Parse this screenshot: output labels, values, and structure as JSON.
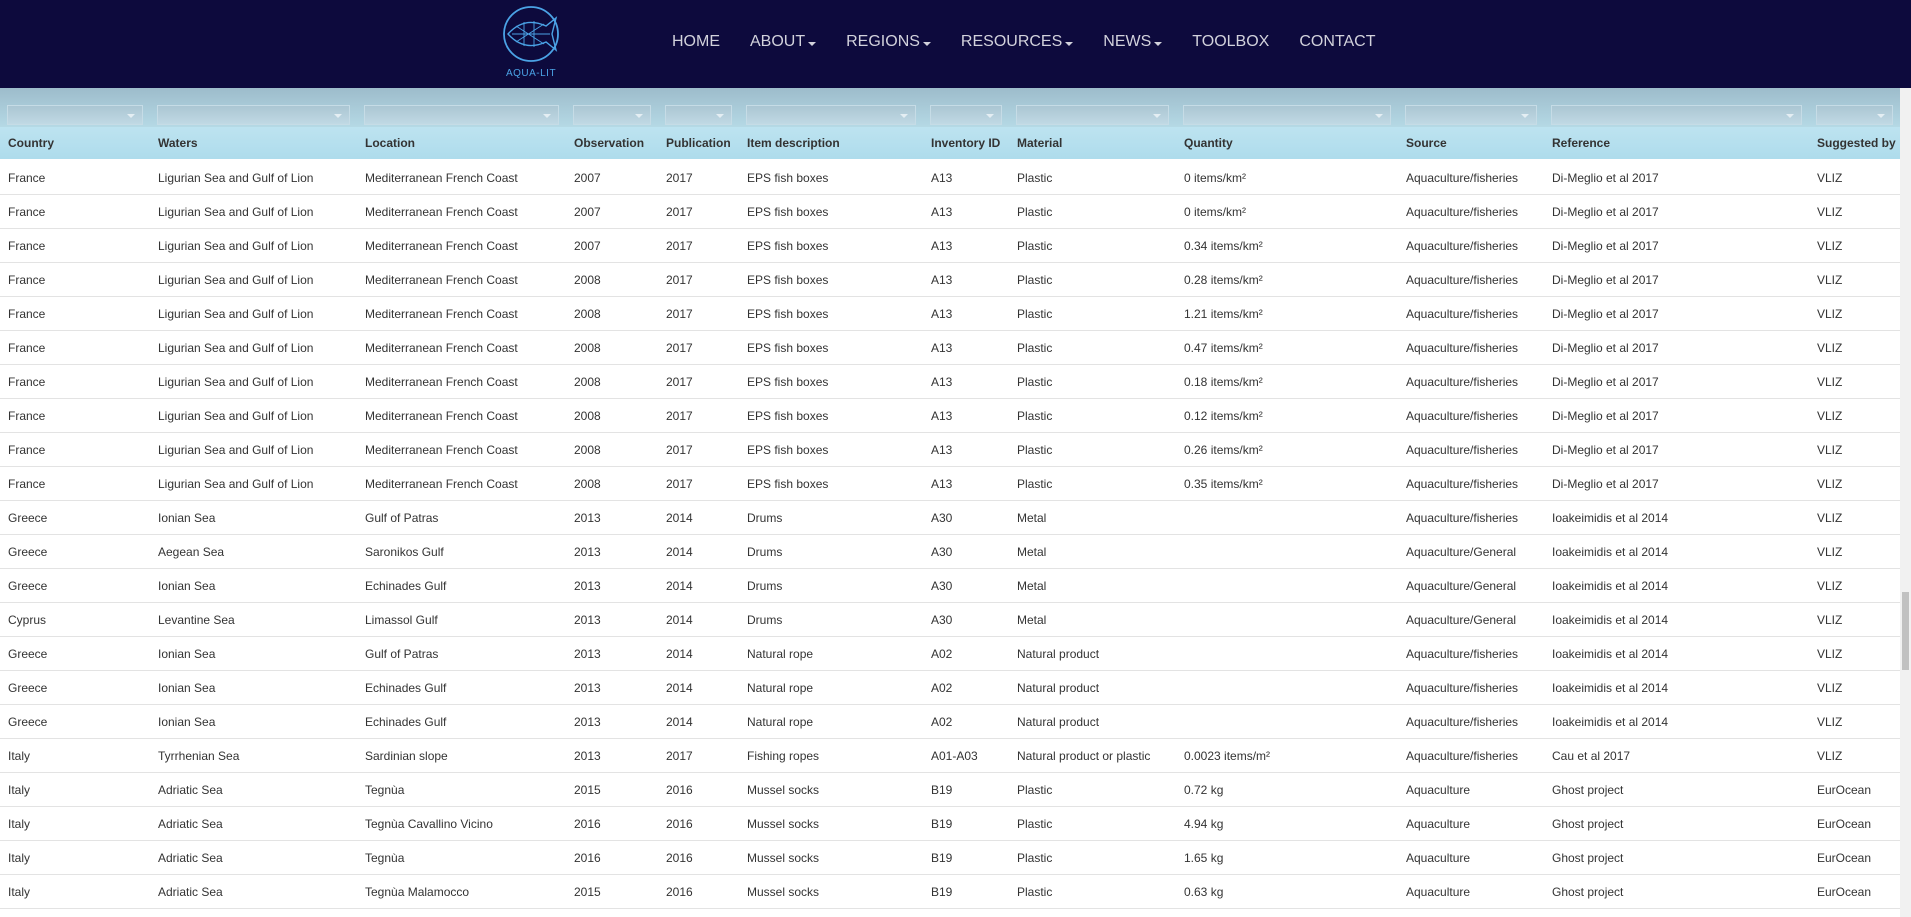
{
  "nav": {
    "logo_text": "AQUA-LIT",
    "items": [
      {
        "label": "HOME",
        "dropdown": false
      },
      {
        "label": "ABOUT",
        "dropdown": true
      },
      {
        "label": "REGIONS",
        "dropdown": true
      },
      {
        "label": "RESOURCES",
        "dropdown": true
      },
      {
        "label": "NEWS",
        "dropdown": true
      },
      {
        "label": "TOOLBOX",
        "dropdown": false
      },
      {
        "label": "CONTACT",
        "dropdown": false
      }
    ]
  },
  "table": {
    "columns": [
      "Country",
      "Waters",
      "Location",
      "Observation",
      "Publication",
      "Item description",
      "Inventory ID",
      "Material",
      "Quantity",
      "Source",
      "Reference",
      "Suggested by"
    ],
    "rows": [
      [
        "France",
        "Ligurian Sea and Gulf of Lion",
        "Mediterranean French Coast",
        "2007",
        "2017",
        "EPS fish boxes",
        "A13",
        "Plastic",
        "0 items/km²",
        "Aquaculture/fisheries",
        "Di-Meglio et al 2017",
        "VLIZ"
      ],
      [
        "France",
        "Ligurian Sea and Gulf of Lion",
        "Mediterranean French Coast",
        "2007",
        "2017",
        "EPS fish boxes",
        "A13",
        "Plastic",
        "0 items/km²",
        "Aquaculture/fisheries",
        "Di-Meglio et al 2017",
        "VLIZ"
      ],
      [
        "France",
        "Ligurian Sea and Gulf of Lion",
        "Mediterranean French Coast",
        "2007",
        "2017",
        "EPS fish boxes",
        "A13",
        "Plastic",
        "0.34 items/km²",
        "Aquaculture/fisheries",
        "Di-Meglio et al 2017",
        "VLIZ"
      ],
      [
        "France",
        "Ligurian Sea and Gulf of Lion",
        "Mediterranean French Coast",
        "2008",
        "2017",
        "EPS fish boxes",
        "A13",
        "Plastic",
        "0.28 items/km²",
        "Aquaculture/fisheries",
        "Di-Meglio et al 2017",
        "VLIZ"
      ],
      [
        "France",
        "Ligurian Sea and Gulf of Lion",
        "Mediterranean French Coast",
        "2008",
        "2017",
        "EPS fish boxes",
        "A13",
        "Plastic",
        "1.21 items/km²",
        "Aquaculture/fisheries",
        "Di-Meglio et al 2017",
        "VLIZ"
      ],
      [
        "France",
        "Ligurian Sea and Gulf of Lion",
        "Mediterranean French Coast",
        "2008",
        "2017",
        "EPS fish boxes",
        "A13",
        "Plastic",
        "0.47 items/km²",
        "Aquaculture/fisheries",
        "Di-Meglio et al 2017",
        "VLIZ"
      ],
      [
        "France",
        "Ligurian Sea and Gulf of Lion",
        "Mediterranean French Coast",
        "2008",
        "2017",
        "EPS fish boxes",
        "A13",
        "Plastic",
        "0.18 items/km²",
        "Aquaculture/fisheries",
        "Di-Meglio et al 2017",
        "VLIZ"
      ],
      [
        "France",
        "Ligurian Sea and Gulf of Lion",
        "Mediterranean French Coast",
        "2008",
        "2017",
        "EPS fish boxes",
        "A13",
        "Plastic",
        "0.12 items/km²",
        "Aquaculture/fisheries",
        "Di-Meglio et al 2017",
        "VLIZ"
      ],
      [
        "France",
        "Ligurian Sea and Gulf of Lion",
        "Mediterranean French Coast",
        "2008",
        "2017",
        "EPS fish boxes",
        "A13",
        "Plastic",
        "0.26 items/km²",
        "Aquaculture/fisheries",
        "Di-Meglio et al 2017",
        "VLIZ"
      ],
      [
        "France",
        "Ligurian Sea and Gulf of Lion",
        "Mediterranean French Coast",
        "2008",
        "2017",
        "EPS fish boxes",
        "A13",
        "Plastic",
        "0.35 items/km²",
        "Aquaculture/fisheries",
        "Di-Meglio et al 2017",
        "VLIZ"
      ],
      [
        "Greece",
        "Ionian Sea",
        "Gulf of Patras",
        "2013",
        "2014",
        "Drums",
        "A30",
        "Metal",
        "",
        "Aquaculture/fisheries",
        "Ioakeimidis et al 2014",
        "VLIZ"
      ],
      [
        "Greece",
        "Aegean Sea",
        "Saronikos Gulf",
        "2013",
        "2014",
        "Drums",
        "A30",
        "Metal",
        "",
        "Aquaculture/General",
        "Ioakeimidis et al 2014",
        "VLIZ"
      ],
      [
        "Greece",
        "Ionian Sea",
        "Echinades Gulf",
        "2013",
        "2014",
        "Drums",
        "A30",
        "Metal",
        "",
        "Aquaculture/General",
        "Ioakeimidis et al 2014",
        "VLIZ"
      ],
      [
        "Cyprus",
        "Levantine Sea",
        "Limassol Gulf",
        "2013",
        "2014",
        "Drums",
        "A30",
        "Metal",
        "",
        "Aquaculture/General",
        "Ioakeimidis et al 2014",
        "VLIZ"
      ],
      [
        "Greece",
        "Ionian Sea",
        "Gulf of Patras",
        "2013",
        "2014",
        "Natural rope",
        "A02",
        "Natural product",
        "",
        "Aquaculture/fisheries",
        "Ioakeimidis et al 2014",
        "VLIZ"
      ],
      [
        "Greece",
        "Ionian Sea",
        "Echinades Gulf",
        "2013",
        "2014",
        "Natural rope",
        "A02",
        "Natural product",
        "",
        "Aquaculture/fisheries",
        "Ioakeimidis et al 2014",
        "VLIZ"
      ],
      [
        "Greece",
        "Ionian Sea",
        "Echinades Gulf",
        "2013",
        "2014",
        "Natural rope",
        "A02",
        "Natural product",
        "",
        "Aquaculture/fisheries",
        "Ioakeimidis et al 2014",
        "VLIZ"
      ],
      [
        "Italy",
        "Tyrrhenian Sea",
        "Sardinian slope",
        "2013",
        "2017",
        "Fishing ropes",
        "A01-A03",
        "Natural product or plastic",
        "0.0023 items/m²",
        "Aquaculture/fisheries",
        "Cau et al 2017",
        "VLIZ"
      ],
      [
        "Italy",
        "Adriatic Sea",
        "Tegnùa",
        "2015",
        "2016",
        "Mussel socks",
        "B19",
        "Plastic",
        "0.72 kg",
        "Aquaculture",
        "Ghost project",
        "EurOcean"
      ],
      [
        "Italy",
        "Adriatic Sea",
        "Tegnùa  Cavallino Vicino",
        "2016",
        "2016",
        "Mussel socks",
        "B19",
        "Plastic",
        "4.94 kg",
        "Aquaculture",
        "Ghost project",
        "EurOcean"
      ],
      [
        "Italy",
        "Adriatic Sea",
        "Tegnùa",
        "2016",
        "2016",
        "Mussel socks",
        "B19",
        "Plastic",
        "1.65 kg",
        "Aquaculture",
        "Ghost project",
        "EurOcean"
      ],
      [
        "Italy",
        "Adriatic Sea",
        "Tegnùa Malamocco",
        "2015",
        "2016",
        "Mussel socks",
        "B19",
        "Plastic",
        "0.63 kg",
        "Aquaculture",
        "Ghost project",
        "EurOcean"
      ]
    ]
  },
  "colors": {
    "navbar_bg": "#0d0a3d",
    "nav_text": "#d2d2dc",
    "logo_blue": "#4ba3e6",
    "header_bg": "#aedcec",
    "row_border": "#e3e3e3"
  },
  "icons": {
    "logo": "fish-globe-logo-icon",
    "dropdown": "caret-down-icon",
    "filter_arrow": "chevron-down-icon"
  }
}
